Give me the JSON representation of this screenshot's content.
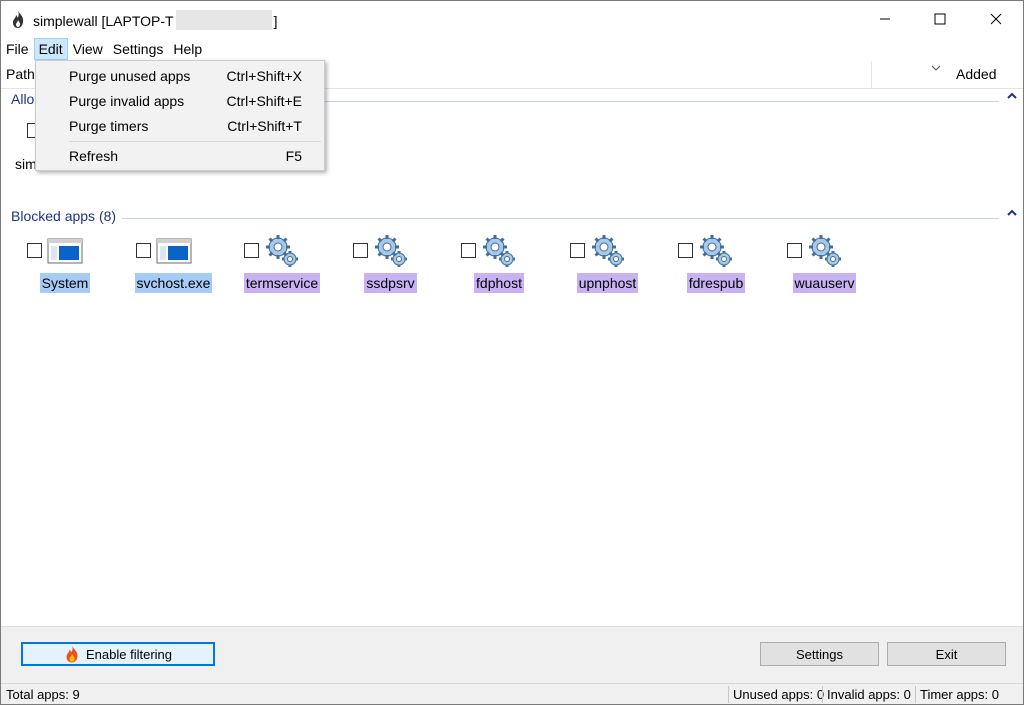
{
  "window": {
    "title_prefix": "simplewall [LAPTOP-T",
    "title_suffix": "]",
    "minimize_glyph": "—",
    "maximize_glyph": "☐",
    "close_glyph": "✕"
  },
  "menu": [
    "File",
    "Edit",
    "View",
    "Settings",
    "Help"
  ],
  "header": {
    "path_label": "Path",
    "added_label": "Added"
  },
  "edit_menu": {
    "items": [
      {
        "label": "Purge unused apps",
        "shortcut": "Ctrl+Shift+X"
      },
      {
        "label": "Purge invalid apps",
        "shortcut": "Ctrl+Shift+E"
      },
      {
        "label": "Purge timers",
        "shortcut": "Ctrl+Shift+T"
      },
      {
        "label": "Refresh",
        "shortcut": "F5"
      }
    ]
  },
  "allowed_group": {
    "title_visible": "Allo",
    "item_label_visible": "sim"
  },
  "blocked_group": {
    "title": "Blocked apps (8)",
    "apps": [
      {
        "label": "System",
        "kind": "system",
        "icon": "window-app-icon"
      },
      {
        "label": "svchost.exe",
        "kind": "system",
        "icon": "window-app-icon"
      },
      {
        "label": "termservice",
        "kind": "service",
        "icon": "gears-service-icon"
      },
      {
        "label": "ssdpsrv",
        "kind": "service",
        "icon": "gears-service-icon"
      },
      {
        "label": "fdphost",
        "kind": "service",
        "icon": "gears-service-icon"
      },
      {
        "label": "upnphost",
        "kind": "service",
        "icon": "gears-service-icon"
      },
      {
        "label": "fdrespub",
        "kind": "service",
        "icon": "gears-service-icon"
      },
      {
        "label": "wuauserv",
        "kind": "service",
        "icon": "gears-service-icon"
      }
    ]
  },
  "buttons": {
    "enable_filtering": "Enable filtering",
    "settings": "Settings",
    "exit": "Exit"
  },
  "status": {
    "total": "Total apps: 9",
    "unused": "Unused apps: 0",
    "invalid": "Invalid apps: 0",
    "timer": "Timer apps: 0"
  },
  "colors": {
    "accent": "#0078d7",
    "group_title": "#1e3287",
    "system_highlight": "#a6cbf6",
    "service_highlight": "#c8b2f3",
    "menu_active": "#cce8ff"
  }
}
